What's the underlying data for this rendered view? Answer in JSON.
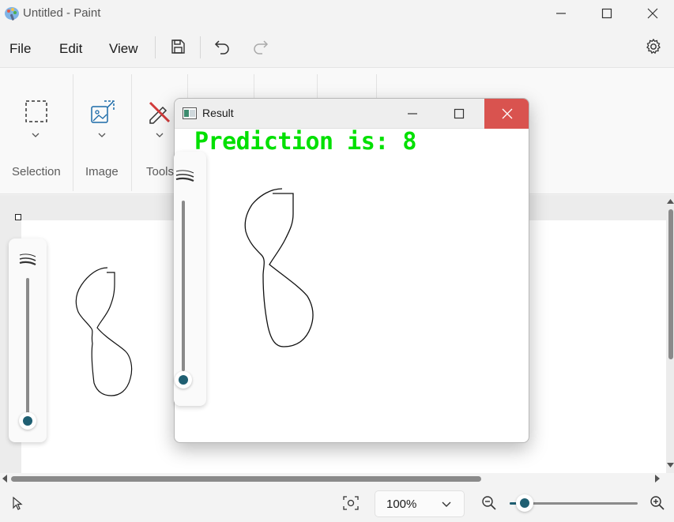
{
  "window": {
    "title": "Untitled - Paint"
  },
  "menu": {
    "file": "File",
    "edit": "Edit",
    "view": "View"
  },
  "ribbon": {
    "selection_label": "Selection",
    "image_label": "Image",
    "tools_label": "Tools"
  },
  "status": {
    "zoom": "100%",
    "zoom_slider_fraction": 0.12
  },
  "brush_size_fraction": 0.0,
  "result_window": {
    "title": "Result",
    "prediction": "Prediction is: 8"
  },
  "colors": {
    "accent": "#1f5f72",
    "prediction_text": "#00e000",
    "close_hover": "#d9534f"
  }
}
